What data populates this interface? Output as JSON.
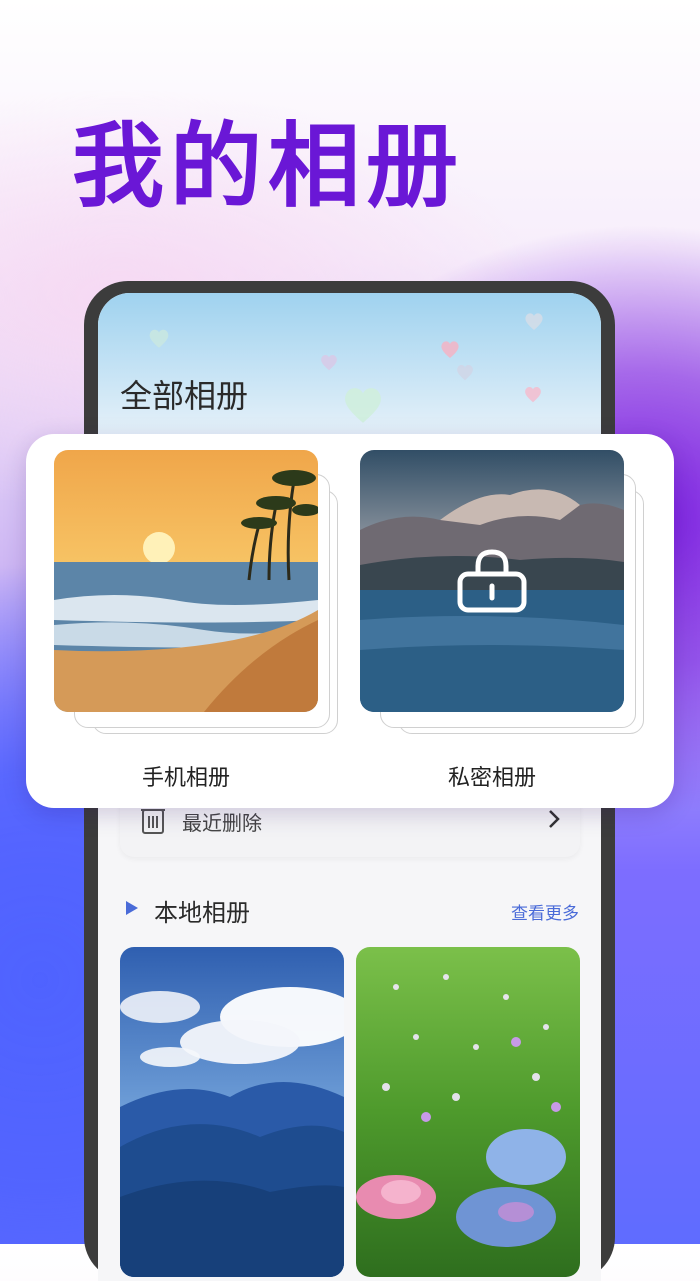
{
  "header": {
    "title": "我的相册"
  },
  "phone_screen": {
    "title": "全部相册",
    "recent_deleted": {
      "label": "最近删除"
    },
    "local_section": {
      "title": "本地相册",
      "see_more": "查看更多"
    }
  },
  "album_panel": {
    "albums": [
      {
        "label": "手机相册",
        "locked": false
      },
      {
        "label": "私密相册",
        "locked": true
      }
    ]
  },
  "colors": {
    "title_purple": "#6a17d6",
    "accent_blue": "#4a6bd8"
  },
  "icons": [
    "heart-icon",
    "trash-icon",
    "chevron-right-icon",
    "play-marker-icon",
    "lock-icon"
  ]
}
